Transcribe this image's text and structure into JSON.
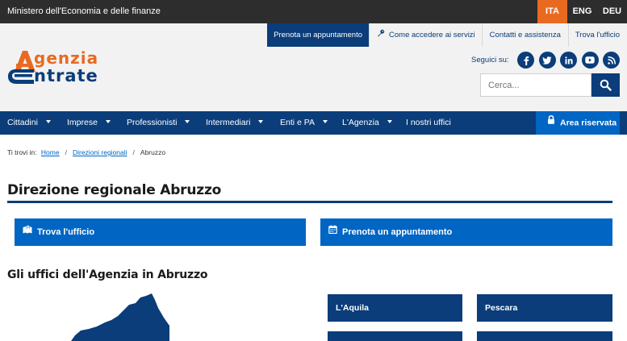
{
  "topbar": {
    "ministry": "Ministero dell'Economia e delle finanze",
    "languages": [
      {
        "label": "ITA",
        "active": true
      },
      {
        "label": "ENG",
        "active": false
      },
      {
        "label": "DEU",
        "active": false
      }
    ]
  },
  "header": {
    "subnav": {
      "prenota": "Prenota un appuntamento",
      "accesso": "Come accedere ai servizi",
      "contatti": "Contatti e assistenza",
      "trova": "Trova l'ufficio"
    },
    "logo": {
      "line1": "genzia",
      "line2": "ntrate"
    },
    "social": {
      "label": "Seguici su:",
      "icons": [
        "facebook-icon",
        "twitter-icon",
        "linkedin-icon",
        "youtube-icon",
        "rss-icon"
      ]
    },
    "search": {
      "placeholder": "Cerca..."
    }
  },
  "nav": {
    "items": [
      "Cittadini",
      "Imprese",
      "Professionisti",
      "Intermediari",
      "Enti e PA",
      "L'Agenzia",
      "I nostri uffici"
    ],
    "area_riservata": "Area riservata"
  },
  "breadcrumb": {
    "prefix": "Ti trovi in:",
    "home": "Home",
    "direzioni": "Direzioni regionali",
    "current": "Abruzzo"
  },
  "page": {
    "title": "Direzione regionale Abruzzo",
    "actions": {
      "trova": "Trova l'ufficio",
      "prenota": "Prenota un appuntamento"
    },
    "offices_title": "Gli uffici dell'Agenzia in Abruzzo",
    "offices": [
      "L'Aquila",
      "Pescara"
    ]
  },
  "colors": {
    "brand_blue": "#0a3d7a",
    "accent_blue": "#0065c3",
    "orange": "#e86a21",
    "topbar": "#2d2d2d"
  }
}
